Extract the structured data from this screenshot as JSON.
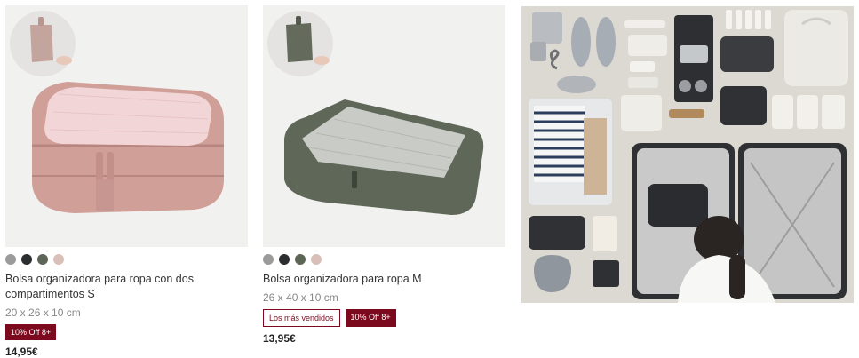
{
  "products": [
    {
      "title": "Bolsa organizadora para ropa con dos compartimentos S",
      "dimensions": "20 x 26 x 10 cm",
      "badges": [],
      "discount": "10% Off 8+",
      "price": "14,95€",
      "swatches": [
        "#9b9b9b",
        "#2b2d2f",
        "#5d6656",
        "#d9bfb8"
      ]
    },
    {
      "title": "Bolsa organizadora para ropa M",
      "dimensions": "26 x 40 x 10 cm",
      "best_seller": "Los más vendidos",
      "discount": "10% Off 8+",
      "price": "13,95€",
      "swatches": [
        "#9b9b9b",
        "#2b2d2f",
        "#5d6656",
        "#d9bfb8"
      ]
    }
  ],
  "colors": {
    "accent": "#7b0a1f",
    "pink_bag": "#d8aca6",
    "green_bag": "#5f6759"
  }
}
